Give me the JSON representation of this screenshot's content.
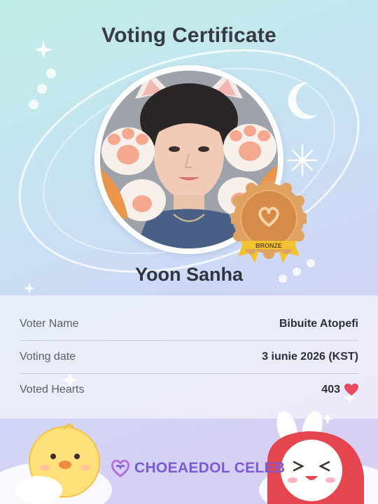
{
  "certificate": {
    "title": "Voting Certificate",
    "idol_name": "Yoon Sanha",
    "badge_label": "BRONZE"
  },
  "details": [
    {
      "label": "Voter Name",
      "value": "Bibuite Atopefi"
    },
    {
      "label": "Voting date",
      "value": "3 iunie 2026 (KST)"
    },
    {
      "label": "Voted Hearts",
      "value": "403"
    }
  ],
  "footer": {
    "brand": "CHOEAEDOL CELEB"
  },
  "colors": {
    "accent": "#7a5ad8",
    "heart": "#e84a5f",
    "bronze": "#d89552",
    "ribbon": "#f4c430"
  },
  "icons": [
    "sparkle-icon",
    "moon-icon",
    "bronze-medal-icon",
    "heart-icon",
    "brand-logo-icon",
    "chick-mascot-icon",
    "bunny-mascot-icon"
  ]
}
